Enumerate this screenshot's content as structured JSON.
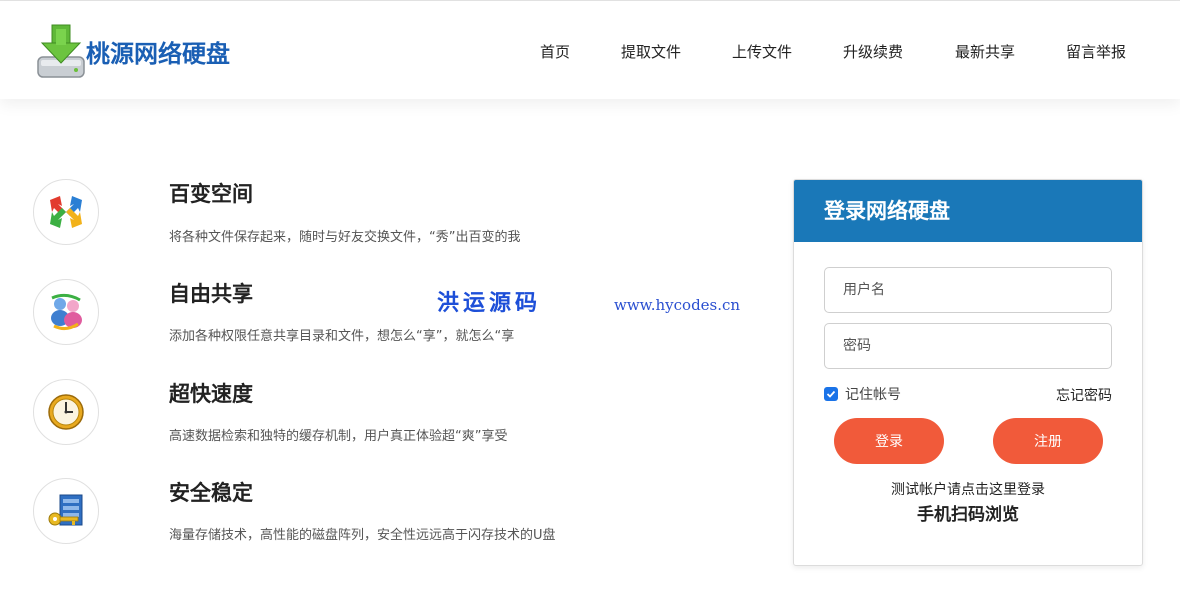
{
  "brand": {
    "name": "桃源网络硬盘",
    "color": "#1a5fb4"
  },
  "nav": [
    {
      "label": "首页"
    },
    {
      "label": "提取文件"
    },
    {
      "label": "上传文件"
    },
    {
      "label": "升级续费"
    },
    {
      "label": "最新共享"
    },
    {
      "label": "留言举报"
    }
  ],
  "features": [
    {
      "title": "百变空间",
      "desc": "将各种文件保存起来，随时与好友交换文件，“秀”出百变的我",
      "icon": "arrows-icon"
    },
    {
      "title": "自由共享",
      "desc": "添加各种权限任意共享目录和文件，想怎么“享”，就怎么“享",
      "icon": "people-icon"
    },
    {
      "title": "超快速度",
      "desc": "高速数据检索和独特的缓存机制，用户真正体验超“爽”享受",
      "icon": "clock-icon"
    },
    {
      "title": "安全稳定",
      "desc": "海量存储技术，高性能的磁盘阵列，安全性远远高于闪存技术的U盘",
      "icon": "key-icon"
    }
  ],
  "watermark": {
    "text": "洪运源码",
    "url": "www.hycodes.cn"
  },
  "login": {
    "title": "登录网络硬盘",
    "header_color": "#1a78b8",
    "username_placeholder": "用户名",
    "password_placeholder": "密码",
    "remember_label": "记住帐号",
    "remember_checked": true,
    "forgot_label": "忘记密码",
    "login_button": "登录",
    "register_button": "注册",
    "button_color": "#f15a3a",
    "test_note": "测试帐户请点击这里登录",
    "mobile_label": "手机扫码浏览"
  }
}
